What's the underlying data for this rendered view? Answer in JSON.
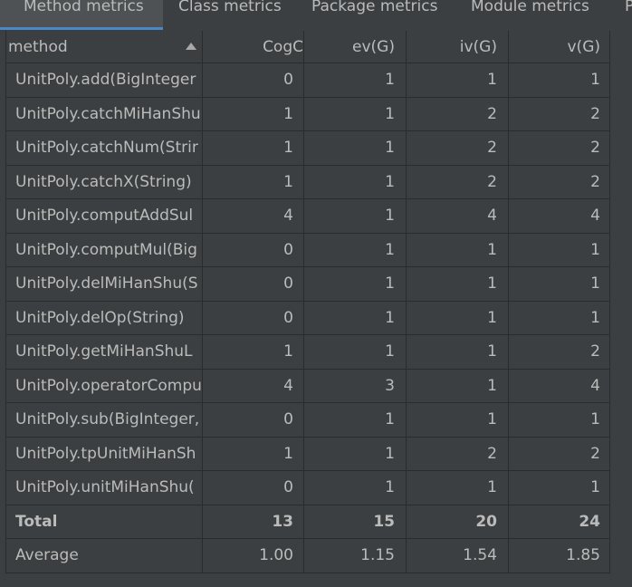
{
  "tabs": [
    {
      "label": "Method metrics",
      "active": true
    },
    {
      "label": "Class metrics",
      "active": false
    },
    {
      "label": "Package metrics",
      "active": false
    },
    {
      "label": "Module metrics",
      "active": false
    },
    {
      "label": "P",
      "active": false
    }
  ],
  "table": {
    "columns": [
      "method",
      "CogC",
      "ev(G)",
      "iv(G)",
      "v(G)"
    ],
    "sort_column": "method",
    "sort_direction": "ascending",
    "rows": [
      [
        "UnitPoly.add(BigInteger",
        "0",
        "1",
        "1",
        "1"
      ],
      [
        "UnitPoly.catchMiHanShu",
        "1",
        "1",
        "2",
        "2"
      ],
      [
        "UnitPoly.catchNum(Strir",
        "1",
        "1",
        "2",
        "2"
      ],
      [
        "UnitPoly.catchX(String)",
        "1",
        "1",
        "2",
        "2"
      ],
      [
        "UnitPoly.computAddSul",
        "4",
        "1",
        "4",
        "4"
      ],
      [
        "UnitPoly.computMul(Big",
        "0",
        "1",
        "1",
        "1"
      ],
      [
        "UnitPoly.delMiHanShu(S",
        "0",
        "1",
        "1",
        "1"
      ],
      [
        "UnitPoly.delOp(String)",
        "0",
        "1",
        "1",
        "1"
      ],
      [
        "UnitPoly.getMiHanShuL",
        "1",
        "1",
        "1",
        "2"
      ],
      [
        "UnitPoly.operatorCompu",
        "4",
        "3",
        "1",
        "4"
      ],
      [
        "UnitPoly.sub(BigInteger,",
        "0",
        "1",
        "1",
        "1"
      ],
      [
        "UnitPoly.tpUnitMiHanSh",
        "1",
        "1",
        "2",
        "2"
      ],
      [
        "UnitPoly.unitMiHanShu(",
        "0",
        "1",
        "1",
        "1"
      ]
    ],
    "total": [
      "Total",
      "13",
      "15",
      "20",
      "24"
    ],
    "average": [
      "Average",
      "1.00",
      "1.15",
      "1.54",
      "1.85"
    ]
  },
  "colors": {
    "background": "#3c3f41",
    "active_tab": "#4e5254",
    "accent": "#4a88c7",
    "text": "#bbbbbb",
    "grid": "#2b2b2b"
  }
}
